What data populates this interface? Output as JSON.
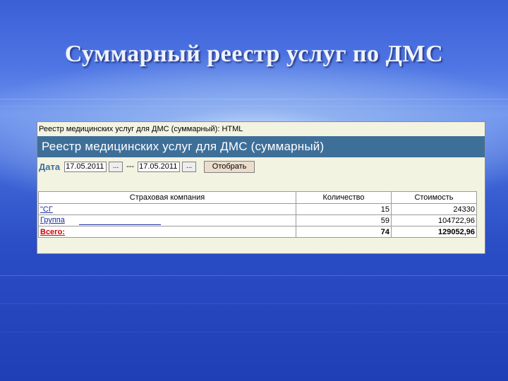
{
  "slide": {
    "title": "Суммарный реестр услуг по ДМС"
  },
  "window": {
    "caption": "Реестр медицинских услуг для ДМС (суммарный): HTML",
    "header": "Реестр медицинских услуг для ДМС (суммарный)"
  },
  "filter": {
    "date_label": "Дата",
    "date_from": "17.05.2011",
    "date_to": "17.05.2011",
    "dots_label": "...",
    "separator": "---",
    "apply_label": "Отобрать"
  },
  "table": {
    "columns": [
      "Страховая компания",
      "Количество",
      "Стоимость"
    ],
    "rows": [
      {
        "company": "\"СГ",
        "qty": "15",
        "cost": "24330"
      },
      {
        "company": "Группа",
        "qty": "59",
        "cost": "104722,96"
      }
    ],
    "total": {
      "label": "Всего:",
      "qty": "74",
      "cost": "129052,96"
    }
  },
  "colors": {
    "header_bg": "#3e6f99",
    "window_bg": "#f3f3e2",
    "total_text": "#cc0000",
    "link_text": "#1a2fa0"
  }
}
